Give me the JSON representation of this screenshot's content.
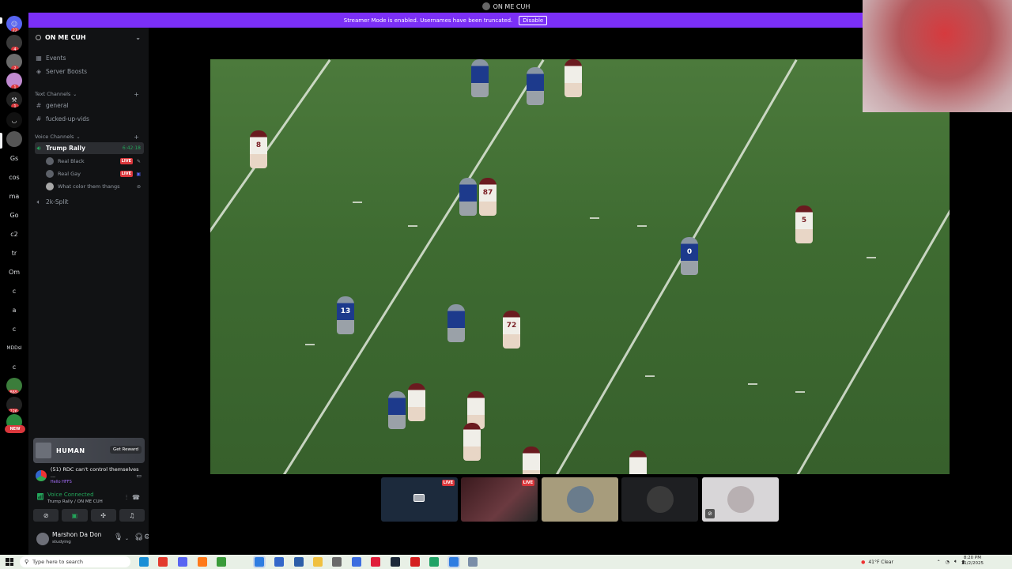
{
  "window": {
    "title": "ON ME CUH"
  },
  "banner": {
    "message": "Streamer Mode is enabled. Usernames have been truncated.",
    "button": "Disable"
  },
  "rail": {
    "items": [
      {
        "label": "",
        "badge": "22",
        "kind": "dm"
      },
      {
        "label": "",
        "badge": "4"
      },
      {
        "label": "",
        "badge": "2"
      },
      {
        "label": "",
        "badge": "1"
      },
      {
        "label": "",
        "badge": "1"
      },
      {
        "label": "",
        "badge": ""
      },
      {
        "label": "",
        "badge": ""
      },
      {
        "label": "Gs"
      },
      {
        "label": "cos"
      },
      {
        "label": "ma"
      },
      {
        "label": "Go"
      },
      {
        "label": "c2"
      },
      {
        "label": "tr"
      },
      {
        "label": "Om"
      },
      {
        "label": "c"
      },
      {
        "label": "a"
      },
      {
        "label": "c"
      },
      {
        "label": "MDDsI"
      },
      {
        "label": "c"
      },
      {
        "label": "",
        "badge": "865"
      },
      {
        "label": "",
        "badge": "226"
      },
      {
        "label": "",
        "badge": ""
      }
    ],
    "new_label": "NEW"
  },
  "sidebar": {
    "server_name": "ON ME CUH",
    "top_items": [
      {
        "label": "Events",
        "icon": "calendar-icon"
      },
      {
        "label": "Server Boosts",
        "icon": "boost-icon"
      }
    ],
    "text_category": "Text Channels",
    "text_channels": [
      "general",
      "fucked-up-vids"
    ],
    "voice_category": "Voice Channels",
    "active_voice": {
      "label": "Trump Rally",
      "timer": "6:42:18"
    },
    "voice_users": [
      {
        "name": "Real Black",
        "live": "LIVE"
      },
      {
        "name": "Real Gay",
        "live": "LIVE"
      },
      {
        "name": "What color them thangs",
        "live": ""
      }
    ],
    "other_voice": "2k-Split"
  },
  "promo": {
    "title": "HUMAN",
    "button": "Get Reward"
  },
  "activity": {
    "title": "(51) RDC can't control themselves ...",
    "subtitle": "Hello HFFS"
  },
  "voice": {
    "status": "Voice Connected",
    "location": "Trump Rally / ON ME CUH"
  },
  "user": {
    "name": "Marshon Da Don",
    "status": "studying"
  },
  "stream": {
    "jerseys_home": [
      "8",
      "87",
      "5",
      "72"
    ],
    "jerseys_away": [
      "0",
      "13"
    ]
  },
  "tiles": [
    {
      "live": "LIVE"
    },
    {
      "live": "LIVE"
    },
    {
      "live": ""
    },
    {
      "live": ""
    },
    {
      "live": ""
    }
  ],
  "taskbar": {
    "search_placeholder": "Type here to search",
    "weather": "41°F  Clear",
    "time": "8:20 PM",
    "date": "11/2/2025"
  },
  "colors": {
    "banner": "#7b2ff7",
    "live": "#da373c",
    "connected": "#23a55a"
  }
}
